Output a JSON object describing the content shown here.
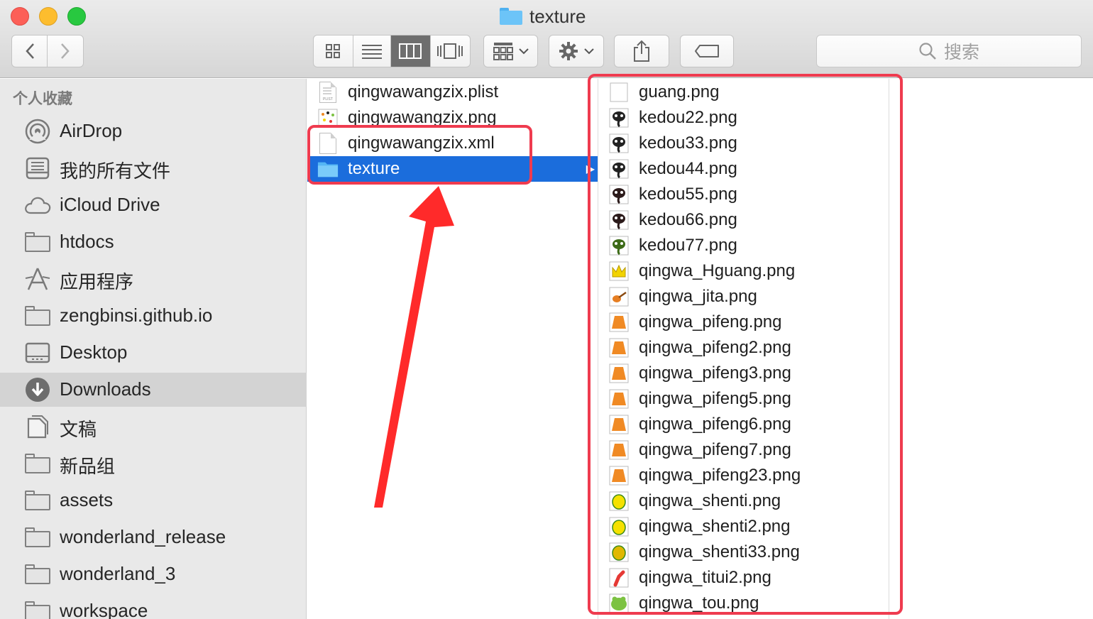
{
  "window": {
    "title": "texture"
  },
  "toolbar": {
    "search_placeholder": "搜索",
    "search_icon": "magnifier-icon",
    "view_modes": [
      "icon-view",
      "list-view",
      "column-view",
      "cover-flow-view"
    ],
    "active_view": "column-view"
  },
  "sidebar": {
    "heading": "个人收藏",
    "items": [
      {
        "label": "AirDrop",
        "icon": "airdrop-icon"
      },
      {
        "label": "我的所有文件",
        "icon": "all-files-icon"
      },
      {
        "label": "iCloud Drive",
        "icon": "cloud-icon"
      },
      {
        "label": "htdocs",
        "icon": "folder-icon"
      },
      {
        "label": "应用程序",
        "icon": "applications-icon"
      },
      {
        "label": "zengbinsi.github.io",
        "icon": "folder-icon"
      },
      {
        "label": "Desktop",
        "icon": "desktop-icon"
      },
      {
        "label": "Downloads",
        "icon": "downloads-icon",
        "selected": true
      },
      {
        "label": "文稿",
        "icon": "documents-icon"
      },
      {
        "label": "新品组",
        "icon": "folder-icon"
      },
      {
        "label": "assets",
        "icon": "folder-icon"
      },
      {
        "label": "wonderland_release",
        "icon": "folder-icon"
      },
      {
        "label": "wonderland_3",
        "icon": "folder-icon"
      },
      {
        "label": "workspace",
        "icon": "folder-icon"
      }
    ]
  },
  "column1": {
    "items": [
      {
        "name": "qingwawangzix.plist",
        "icon": "plist-file-icon"
      },
      {
        "name": "qingwawangzix.png",
        "icon": "png-thumbnail-icon"
      },
      {
        "name": "qingwawangzix.xml",
        "icon": "blank-document-icon"
      },
      {
        "name": "texture",
        "icon": "blue-folder-icon",
        "selected": true
      }
    ]
  },
  "column2": {
    "items": [
      {
        "name": "guang.png",
        "icon": "blank-image-icon",
        "color": "#ffffff"
      },
      {
        "name": "kedou22.png",
        "icon": "tadpole-icon",
        "color": "#222222"
      },
      {
        "name": "kedou33.png",
        "icon": "tadpole-icon",
        "color": "#222222"
      },
      {
        "name": "kedou44.png",
        "icon": "tadpole-icon",
        "color": "#222222"
      },
      {
        "name": "kedou55.png",
        "icon": "tadpole-icon",
        "color": "#2b1a1a"
      },
      {
        "name": "kedou66.png",
        "icon": "tadpole-icon",
        "color": "#2b1a1a"
      },
      {
        "name": "kedou77.png",
        "icon": "tadpole-icon",
        "color": "#3d6b18"
      },
      {
        "name": "qingwa_Hguang.png",
        "icon": "crown-icon",
        "color": "#f2d300"
      },
      {
        "name": "qingwa_jita.png",
        "icon": "guitar-icon",
        "color": "#e67e22"
      },
      {
        "name": "qingwa_pifeng.png",
        "icon": "cape-icon",
        "color": "#f08a24"
      },
      {
        "name": "qingwa_pifeng2.png",
        "icon": "cape-icon",
        "color": "#f08a24"
      },
      {
        "name": "qingwa_pifeng3.png",
        "icon": "cape-icon",
        "color": "#f08a24"
      },
      {
        "name": "qingwa_pifeng5.png",
        "icon": "cape-icon",
        "color": "#f08a24"
      },
      {
        "name": "qingwa_pifeng6.png",
        "icon": "cape-icon",
        "color": "#f08a24"
      },
      {
        "name": "qingwa_pifeng7.png",
        "icon": "cape-icon",
        "color": "#f08a24"
      },
      {
        "name": "qingwa_pifeng23.png",
        "icon": "cape-icon",
        "color": "#f08a24"
      },
      {
        "name": "qingwa_shenti.png",
        "icon": "frog-body-icon",
        "color": "#f5e100"
      },
      {
        "name": "qingwa_shenti2.png",
        "icon": "frog-body-icon",
        "color": "#f5e100"
      },
      {
        "name": "qingwa_shenti33.png",
        "icon": "frog-body-icon",
        "color": "#e0b800"
      },
      {
        "name": "qingwa_titui2.png",
        "icon": "frog-leg-icon",
        "color": "#e53935"
      },
      {
        "name": "qingwa_tou.png",
        "icon": "frog-head-icon",
        "color": "#7cc242"
      }
    ]
  },
  "annotations": {
    "highlight_color": "#ef3b4f",
    "arrow_color": "#ff2a2a"
  }
}
